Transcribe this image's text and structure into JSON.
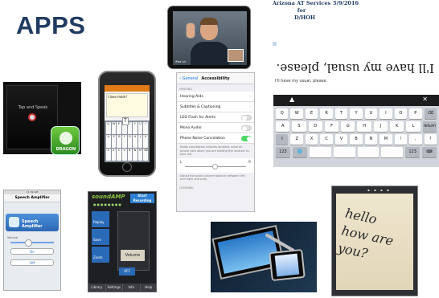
{
  "slide": {
    "title": "APPS",
    "header_org": "Arizona AT Services for",
    "header_org2": "D/HOH",
    "header_date": "5/9/2016"
  },
  "dragon": {
    "screen_text": "Tap and Speak",
    "logo_label": "DRAGON"
  },
  "iphone_note": {
    "text": "I love mom!",
    "key_preview": "T",
    "keys": [
      "Q",
      "W",
      "E",
      "R",
      "T",
      "Y",
      "U",
      "I",
      "A",
      "S",
      "D",
      "F",
      "G",
      "H",
      "J",
      "K",
      "Z",
      "X",
      "C",
      "V",
      "B",
      "N",
      "M",
      "⌫"
    ]
  },
  "facetime": {
    "caption": "iPad Air"
  },
  "accessibility": {
    "back": "General",
    "title": "Accessibility",
    "section": "HEARING",
    "rows": [
      {
        "label": "Hearing Aids",
        "type": "chevron"
      },
      {
        "label": "Subtitles & Captioning",
        "type": "chevron"
      },
      {
        "label": "LED Flash for Alerts",
        "type": "toggle",
        "on": false
      },
      {
        "label": "Mono Audio",
        "type": "toggle",
        "on": false
      },
      {
        "label": "Phone Noise Cancelation",
        "type": "toggle",
        "on": true
      }
    ],
    "noise_note": "Noise cancelation reduces ambient noise on phone calls when you are holding the receiver to your ear.",
    "slider_left": "L",
    "slider_right": "R",
    "balance_note": "Adjust the audio volume balance between left and right channels.",
    "learning": "LEARNING"
  },
  "ipad_keyboard": {
    "flipped_text": "I'll have my usual, please.",
    "typed_text": "I'll have my usual, please.",
    "rows": [
      [
        "Q",
        "W",
        "E",
        "R",
        "T",
        "Y",
        "U",
        "I",
        "O",
        "P",
        "⌫"
      ],
      [
        "A",
        "S",
        "D",
        "F",
        "G",
        "H",
        "J",
        "K",
        "L",
        "return"
      ],
      [
        "⇧",
        "Z",
        "X",
        "C",
        "V",
        "B",
        "N",
        "M",
        "!",
        ",",
        "?"
      ],
      [
        "123",
        "🌐",
        "",
        "",
        "",
        "",
        "123",
        "⌨"
      ]
    ]
  },
  "speech_amp": {
    "status": "11:32 AM",
    "header": "Speech Amplifier",
    "banner": "Speech Amplifier",
    "volume_label": "Volume",
    "btn1": "On",
    "btn2": "Off"
  },
  "sound_amp": {
    "logo": "soundAMP",
    "start": "Start Recording",
    "buttons": [
      "Replay",
      "Save",
      "Zoom"
    ],
    "volume": "Volume",
    "off": "OFF",
    "tabs": [
      "Library",
      "Settings",
      "Info",
      "Help"
    ]
  },
  "handwriting": {
    "lines": [
      "hello",
      "how are",
      "you?"
    ]
  }
}
